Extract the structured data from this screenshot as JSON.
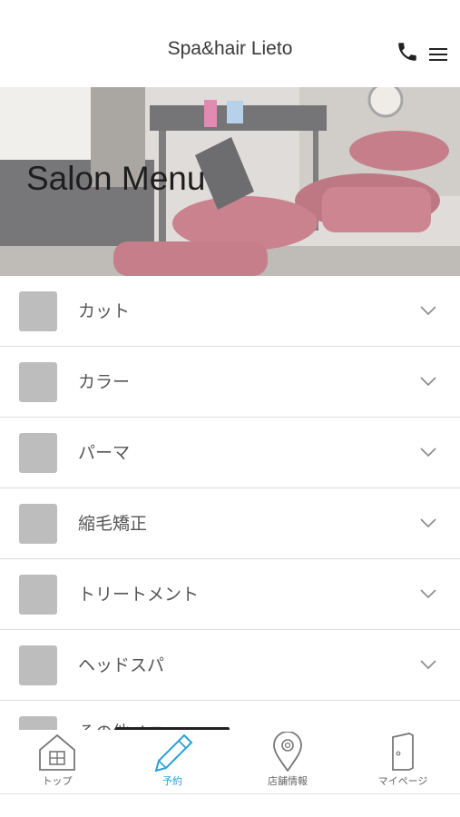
{
  "header": {
    "title": "Spa&hair Lieto",
    "phone_icon": "phone-icon",
    "menu_icon": "hamburger-menu-icon"
  },
  "hero": {
    "title": "Salon Menu"
  },
  "menu_items": [
    {
      "label": "カット"
    },
    {
      "label": "カラー"
    },
    {
      "label": "パーマ"
    },
    {
      "label": "縮毛矯正"
    },
    {
      "label": "トリートメント"
    },
    {
      "label": "ヘッドスパ"
    },
    {
      "label": "その他メニュー"
    }
  ],
  "tabbar": {
    "items": [
      {
        "label": "トップ",
        "icon": "home-icon",
        "active": false
      },
      {
        "label": "予約",
        "icon": "pencil-icon",
        "active": true
      },
      {
        "label": "店舗情報",
        "icon": "map-pin-icon",
        "active": false
      },
      {
        "label": "マイページ",
        "icon": "door-icon",
        "active": false
      }
    ],
    "active_color": "#2a9fd8"
  }
}
